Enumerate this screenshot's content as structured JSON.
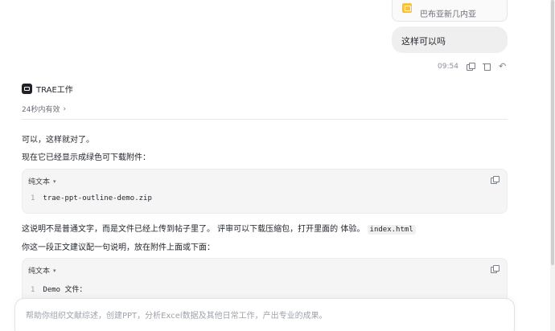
{
  "user_message": {
    "attachment_name": "巴布亚新几内亚",
    "text": "这样可以吗",
    "time": "09:54"
  },
  "agent": {
    "name": "TRAE工作",
    "validity": "24秒内有效"
  },
  "response": {
    "line1": "可以，这样就对了。",
    "line2": "现在它已经显示成绿色可下载附件：",
    "code1": {
      "lang": "纯文本",
      "line_no": "1",
      "code": "trae-ppt-outline-demo.zip"
    },
    "line3": "这说明不是普通文字，而是文件已经上传到帖子里了。 评审可以下载压缩包，打开里面的 体验。",
    "line3_code": "index.html",
    "line4": "你这一段正文建议配一句说明，放在附件上面或下面：",
    "code2": {
      "lang": "纯文本",
      "line_no": "1",
      "code": "Demo 文件："
    }
  },
  "composer": {
    "placeholder": "帮助你组织文献综述，创建PPT，分析Excel数据及其他日常工作，产出专业的成果。"
  }
}
